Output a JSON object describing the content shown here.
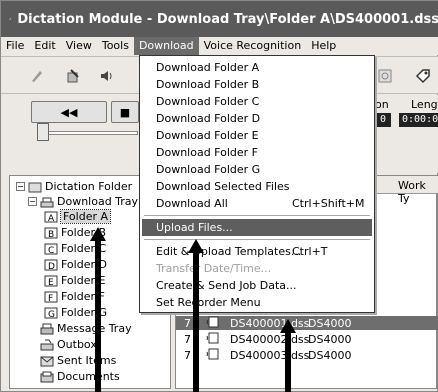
{
  "window": {
    "title": "Dictation Module - Download Tray\\Folder A\\DS400001.dss"
  },
  "menubar": {
    "items": [
      "File",
      "Edit",
      "View",
      "Tools",
      "Download",
      "Voice Recognition",
      "Help"
    ],
    "active": "Download"
  },
  "transport": {
    "rewind_label": "◀◀",
    "stop_label": "■",
    "position_label": "on",
    "length_label": "Lengt",
    "position_value": "0",
    "length_value": "0:00:0"
  },
  "download_menu": {
    "items": [
      {
        "label": "Download Folder A",
        "shortcut": ""
      },
      {
        "label": "Download Folder B",
        "shortcut": ""
      },
      {
        "label": "Download Folder C",
        "shortcut": ""
      },
      {
        "label": "Download Folder D",
        "shortcut": ""
      },
      {
        "label": "Download Folder E",
        "shortcut": ""
      },
      {
        "label": "Download Folder F",
        "shortcut": ""
      },
      {
        "label": "Download Folder G",
        "shortcut": ""
      },
      {
        "label": "Download Selected Files",
        "shortcut": ""
      },
      {
        "label": "Download All",
        "shortcut": "Ctrl+Shift+M"
      },
      {
        "label": "Upload Files...",
        "shortcut": ""
      },
      {
        "label": "Edit & Upload Templates...",
        "shortcut": "Ctrl+T"
      },
      {
        "label": "Transfer Date/Time...",
        "shortcut": ""
      },
      {
        "label": "Create & Send Job Data...",
        "shortcut": ""
      },
      {
        "label": "Set Recorder Menu",
        "shortcut": ""
      }
    ],
    "highlighted": "Upload Files...",
    "disabled": [
      "Transfer Date/Time..."
    ]
  },
  "tree": {
    "root": "Dictation Folder",
    "download_tray": "Download Tray",
    "folders": [
      "Folder A",
      "Folder B",
      "Folder C",
      "Folder D",
      "Folder E",
      "Folder F",
      "Folder G"
    ],
    "selected": "Folder A",
    "message_tray": "Message Tray",
    "outbox": "Outbox",
    "sent_items": "Sent Items",
    "documents": "Documents"
  },
  "list": {
    "column_work_type": "Work Ty",
    "rows": [
      {
        "num": "7",
        "file": "DS400001.dss",
        "author": "DS4000",
        "selected": true
      },
      {
        "num": "7",
        "file": "DS400002.dss",
        "author": "DS4000",
        "selected": false
      },
      {
        "num": "7",
        "file": "DS400003.dss",
        "author": "DS4000",
        "selected": false
      }
    ]
  }
}
